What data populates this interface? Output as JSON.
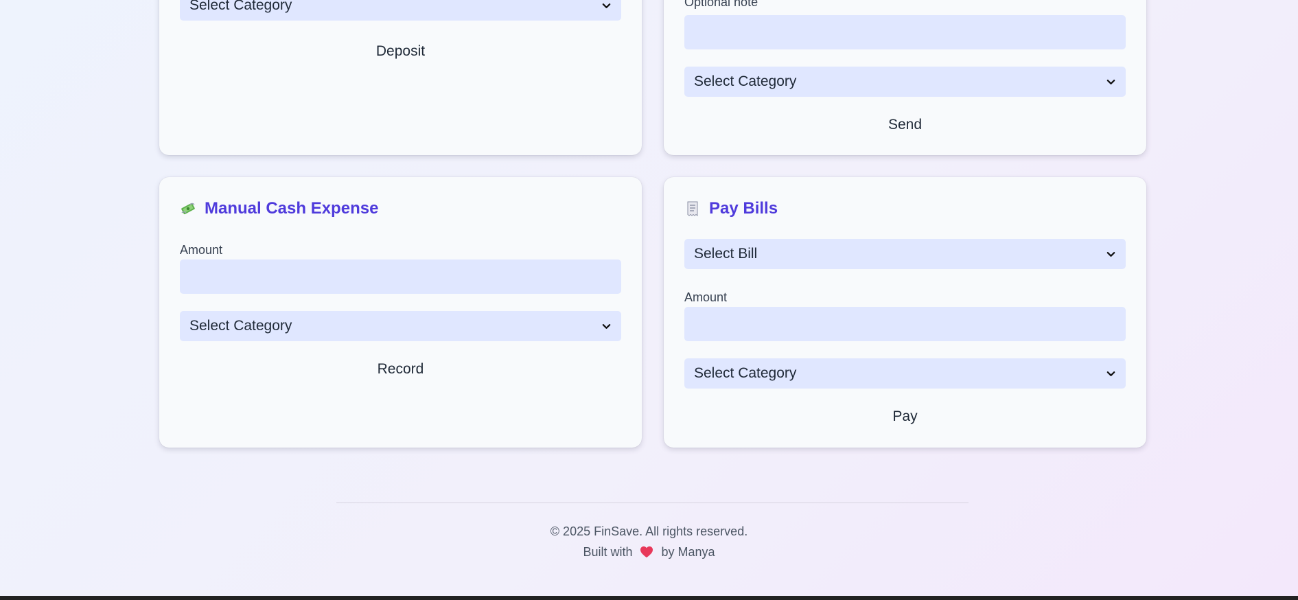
{
  "deposit_card": {
    "category_select": "Select Category",
    "submit_label": "Deposit"
  },
  "send_card": {
    "note_label": "Optional note",
    "note_value": "",
    "category_select": "Select Category",
    "submit_label": "Send"
  },
  "cash_card": {
    "title": "Manual Cash Expense",
    "icon": "money-with-wings-icon",
    "amount_label": "Amount",
    "amount_value": "",
    "category_select": "Select Category",
    "submit_label": "Record"
  },
  "bills_card": {
    "title": "Pay Bills",
    "icon": "receipt-icon",
    "bill_select": "Select Bill",
    "amount_label": "Amount",
    "amount_value": "",
    "category_select": "Select Category",
    "submit_label": "Pay"
  },
  "footer": {
    "copyright": "© 2025 FinSave. All rights reserved.",
    "built_prefix": "Built with",
    "built_suffix": "by Manya",
    "heart_icon": "heart-icon"
  },
  "colors": {
    "accent": "#4f3bdc",
    "field_bg": "#e0e7ff",
    "card_bg": "#f8fafc"
  }
}
